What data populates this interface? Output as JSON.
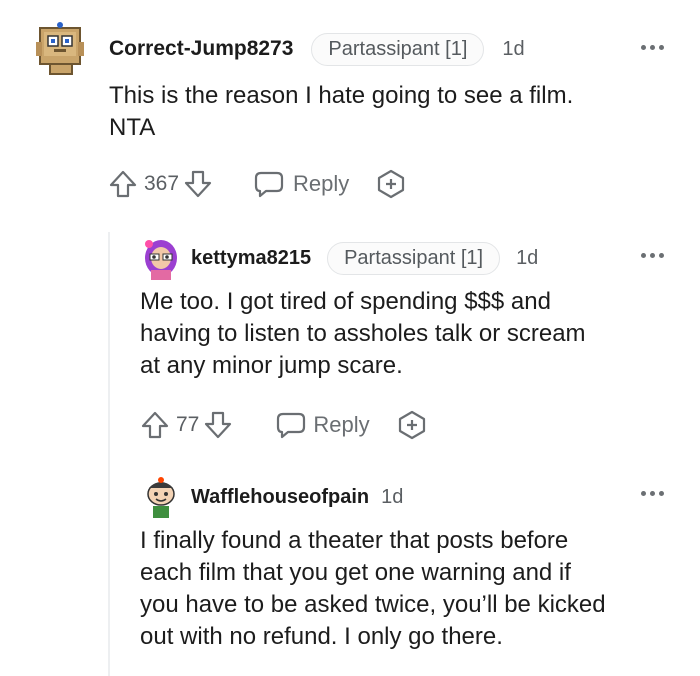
{
  "comments": [
    {
      "username": "Correct-Jump8273",
      "flair": "Partassipant [1]",
      "time": "1d",
      "body_line1": "This is the reason I hate going to see a film.",
      "body_line2": "NTA",
      "votes": "367",
      "reply_label": "Reply",
      "avatar": "box-robot-avatar"
    },
    {
      "username": "kettyma8215",
      "flair": "Partassipant [1]",
      "time": "1d",
      "body_line1": "Me too. I got tired of spending $$$ and",
      "body_line2": "having to listen to assholes talk or scream",
      "body_line3": "at any minor jump scare.",
      "votes": "77",
      "reply_label": "Reply",
      "avatar": "purple-hair-avatar"
    },
    {
      "username": "Wafflehouseofpain",
      "time": "1d",
      "body_line1": "I finally found a theater that posts before",
      "body_line2": "each film that you get one warning and if",
      "body_line3": "you have to be asked twice, you’ll be kicked",
      "body_line4": "out with no refund. I only go there.",
      "avatar": "snoo-avatar"
    }
  ],
  "colors": {
    "text": "#1c1c1c",
    "muted": "#6a6e72",
    "flair_border": "#e3e5e7",
    "thread_line": "#edeff1"
  }
}
